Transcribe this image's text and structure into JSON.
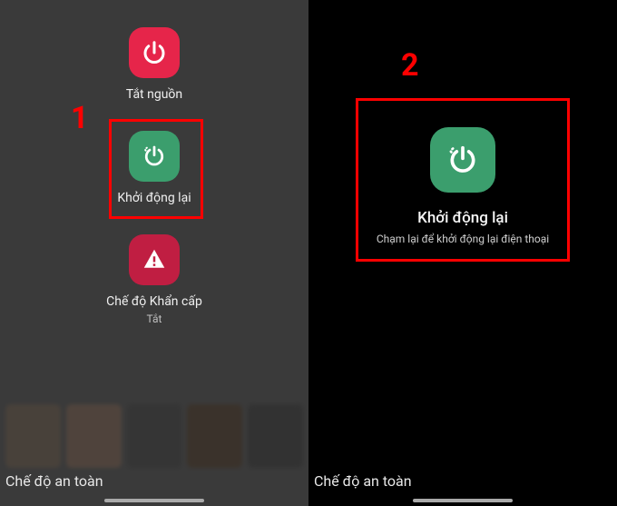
{
  "step1": {
    "number": "1",
    "power_off_label": "Tắt nguồn",
    "restart_label": "Khởi động lại",
    "emergency_label": "Chế độ Khẩn cấp",
    "emergency_sub": "Tắt",
    "safe_mode": "Chế độ an toàn"
  },
  "step2": {
    "number": "2",
    "restart_label": "Khởi động lại",
    "restart_sub": "Chạm lại để khởi động lại điện thoại",
    "safe_mode": "Chế độ an toàn"
  },
  "colors": {
    "accent_red": "#e6254a",
    "accent_green": "#3b9e6d",
    "highlight": "#ff0000"
  }
}
